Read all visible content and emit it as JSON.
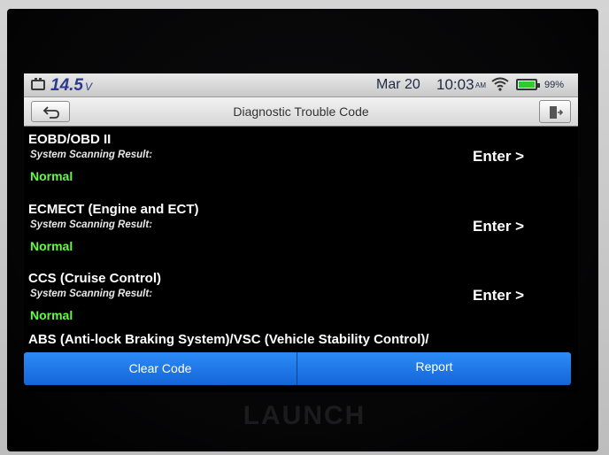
{
  "status_bar": {
    "voltage": "14.5",
    "voltage_unit": "V",
    "date": "Mar 20",
    "time": "10:03",
    "ampm": "AM",
    "battery_percent": "99%",
    "icons": [
      "car-battery-icon",
      "wifi-icon",
      "battery-icon"
    ],
    "battery_color": "#2ecc2e"
  },
  "title_bar": {
    "title": "Diagnostic Trouble Code",
    "icons": [
      "back-arrow-icon",
      "exit-icon"
    ]
  },
  "systems": [
    {
      "name": "EOBD/OBD II",
      "subtitle": "System Scanning Result:",
      "status": "Normal",
      "action": "Enter >"
    },
    {
      "name": "ECMECT (Engine and ECT)",
      "subtitle": "System Scanning Result:",
      "status": "Normal",
      "action": "Enter >"
    },
    {
      "name": "CCS (Cruise Control)",
      "subtitle": "System Scanning Result:",
      "status": "Normal",
      "action": "Enter >"
    }
  ],
  "partial_item": "ABS (Anti-lock Braking System)/VSC (Vehicle Stability Control)/",
  "buttons": {
    "clear": "Clear Code",
    "report": "Report",
    "color": "#1e7ae8"
  },
  "brand": "LAUNCH",
  "colors": {
    "status_normal": "#5cff3a",
    "background": "#000000"
  }
}
